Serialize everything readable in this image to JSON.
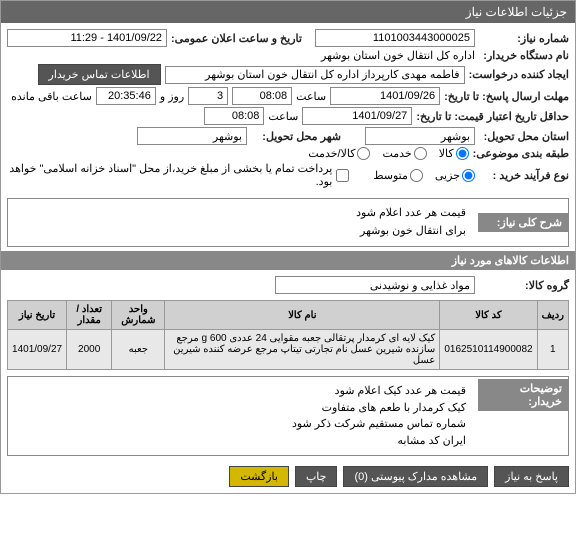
{
  "header": {
    "title": "جزئیات اطلاعات نیاز"
  },
  "fields": {
    "need_no_label": "شماره نیاز:",
    "need_no": "1101003443000025",
    "announce_label": "تاریخ و ساعت اعلان عمومی:",
    "announce": "1401/09/22 - 11:29",
    "buyer_label": "نام دستگاه خریدار:",
    "buyer": "اداره کل انتقال خون استان بوشهر",
    "creator_label": "ایجاد کننده درخواست:",
    "creator": "فاطمه مهدی کارپرداز اداره کل انتقال خون استان بوشهر",
    "contact_btn": "اطلاعات تماس خریدار",
    "deadline_label": "مهلت ارسال پاسخ: تا تاریخ:",
    "deadline_date": "1401/09/26",
    "saat": "ساعت",
    "deadline_time": "08:08",
    "days_val": "3",
    "days_lbl": "روز و",
    "remain_time": "20:35:46",
    "remain_lbl": "ساعت باقی مانده",
    "validity_label": "حداقل تاریخ اعتبار قیمت: تا تاریخ:",
    "validity_date": "1401/09/27",
    "validity_time": "08:08",
    "province_label": "استان محل تحویل:",
    "province": "بوشهر",
    "city_label": "شهر محل تحویل:",
    "city": "بوشهر",
    "category_label": "طبقه بندی موضوعی:",
    "cat_goods": "کالا",
    "cat_service": "خدمت",
    "cat_both": "کالا/خدمت",
    "purchase_label": "نوع فرآیند خرید :",
    "p_small": "جزیی",
    "p_med": "متوسط",
    "payment_note": "پرداخت تمام یا بخشی از مبلغ خرید،از محل \"اسناد خزانه اسلامی\" خواهد بود."
  },
  "desc_section": {
    "title": "شرح کلی نیاز:",
    "line1": "قیمت هر عدد اعلام شود",
    "line2": "برای انتقال خون بوشهر"
  },
  "items_section": {
    "title": "اطلاعات کالاهای مورد نیاز",
    "group_label": "گروه کالا:",
    "group_value": "مواد غذایی و نوشیدنی"
  },
  "table": {
    "h_row": "ردیف",
    "h_code": "کد کالا",
    "h_name": "نام کالا",
    "h_unit": "واحد شمارش",
    "h_qty": "تعداد / مقدار",
    "h_date": "تاریخ نیاز",
    "r1_row": "1",
    "r1_code": "0162510114900082",
    "r1_name": "کیک لایه ای کرمدار پرتقالی جعبه مقوایی 24 عددی 600 g مرجع سازنده شیرین عسل نام تجارتی تیتاپ مرجع عرضه کننده شیرین عسل",
    "r1_unit": "جعبه",
    "r1_qty": "2000",
    "r1_date": "1401/09/27"
  },
  "buyer_desc": {
    "label": "توضیحات خریدار:",
    "l1": "قیمت هر عدد کیک اعلام شود",
    "l2": "کیک کرمدار با طعم های متفاوت",
    "l3": "شماره تماس مستقیم شرکت ذکر شود",
    "l4": "ایران کد مشابه"
  },
  "footer": {
    "reply": "پاسخ به نیاز",
    "docs": "مشاهده مدارک پیوستی (0)",
    "print": "چاپ",
    "back": "بازگشت"
  }
}
